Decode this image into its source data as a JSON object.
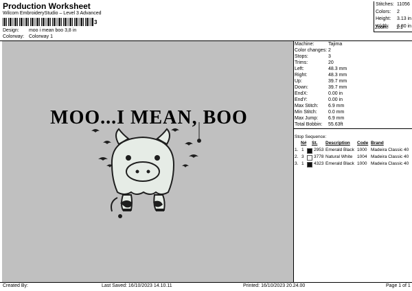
{
  "header": {
    "title": "Production Worksheet",
    "subtitle": "Wilcom EmbroideryStudio – Level 3 Advanced",
    "barcode_value": "3",
    "design_label": "Design:",
    "design_value": "moo i mean boo 3,8 in",
    "colorway_label": "Colorway:",
    "colorway_value": "Colorway 1"
  },
  "summary": {
    "rows": [
      {
        "k": "Stitches:",
        "v": "11056"
      },
      {
        "k": "Colors:",
        "v": "2"
      },
      {
        "k": "Height:",
        "v": "3.13 in"
      },
      {
        "k": "Width:",
        "v": "3.80 in"
      },
      {
        "k": "Zoom:",
        "v": "1:1"
      }
    ]
  },
  "design": {
    "text": "MOO...I MEAN, BOO",
    "colors": {
      "fabric": "#c0c0c0",
      "fill": "#e6ece6",
      "black": "#1e1e1e"
    }
  },
  "info": {
    "rows": [
      {
        "k": "Machine:",
        "v": "Tajima"
      },
      {
        "k": "Color changes:",
        "v": "2"
      },
      {
        "k": "Stops:",
        "v": "3"
      },
      {
        "k": "Trims:",
        "v": "20"
      },
      {
        "k": "Left:",
        "v": "48.3 mm"
      },
      {
        "k": "Right:",
        "v": "48.3 mm"
      },
      {
        "k": "Up:",
        "v": "39.7 mm"
      },
      {
        "k": "Down:",
        "v": "39.7 mm"
      },
      {
        "k": "EndX:",
        "v": "0.00 in"
      },
      {
        "k": "EndY:",
        "v": "0.00 in"
      },
      {
        "k": "Max Stitch:",
        "v": "6.9 mm"
      },
      {
        "k": "Min Stitch:",
        "v": "0.0 mm"
      },
      {
        "k": "Max Jump:",
        "v": "6.9 mm"
      },
      {
        "k": "Total Bobbin:",
        "v": "55.63ft"
      }
    ]
  },
  "stop_sequence": {
    "label": "Stop Sequence:",
    "headers": {
      "n": "N#",
      "st": "St.",
      "desc": "Description",
      "code": "Code",
      "brand": "Brand"
    },
    "rows": [
      {
        "idx": "1.",
        "n": "1",
        "color": "#111111",
        "st": "2953",
        "desc": "Emerald Black",
        "code": "1000",
        "brand": "Madeira Classic 40"
      },
      {
        "idx": "2.",
        "n": "3",
        "color": "#f4f4f4",
        "st": "3778",
        "desc": "Natural White",
        "code": "1004",
        "brand": "Madeira Classic 40"
      },
      {
        "idx": "3.",
        "n": "1",
        "color": "#111111",
        "st": "4323",
        "desc": "Emerald Black",
        "code": "1000",
        "brand": "Madeira Classic 40"
      }
    ]
  },
  "footer": {
    "created_by": "Created By:",
    "last_saved": "Last Saved: 16/10/2023 14.10.11",
    "printed": "Printed: 16/10/2023 20.24.00",
    "page": "Page 1 of 1"
  }
}
